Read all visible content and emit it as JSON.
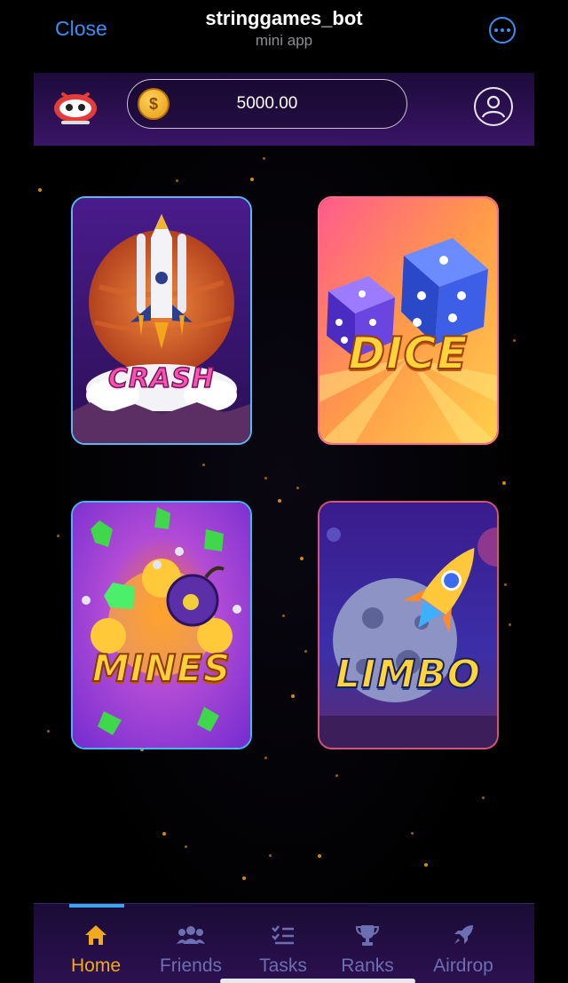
{
  "topbar": {
    "close_label": "Close",
    "title": "stringgames_bot",
    "subtitle": "mini app",
    "more_icon": "ellipsis-circle-icon",
    "accent": "#3d8df5"
  },
  "header": {
    "logo_icon": "gamepad-mascot-icon",
    "balance": "5000.00",
    "coin_icon": "dollar-coin-icon",
    "profile_icon": "user-circle-icon"
  },
  "games": [
    {
      "title": "CRASH",
      "theme": "rocket-launch"
    },
    {
      "title": "DICE",
      "theme": "dice"
    },
    {
      "title": "MINES",
      "theme": "bomb-gems"
    },
    {
      "title": "LIMBO",
      "theme": "rocket-asteroid"
    }
  ],
  "nav": {
    "active": "Home",
    "active_color": "#f2a91c",
    "inactive_color": "#6c6fb2",
    "items": [
      {
        "label": "Home",
        "icon": "home-icon"
      },
      {
        "label": "Friends",
        "icon": "group-icon"
      },
      {
        "label": "Tasks",
        "icon": "checklist-icon"
      },
      {
        "label": "Ranks",
        "icon": "trophy-icon"
      },
      {
        "label": "Airdrop",
        "icon": "rocket-icon"
      }
    ]
  }
}
